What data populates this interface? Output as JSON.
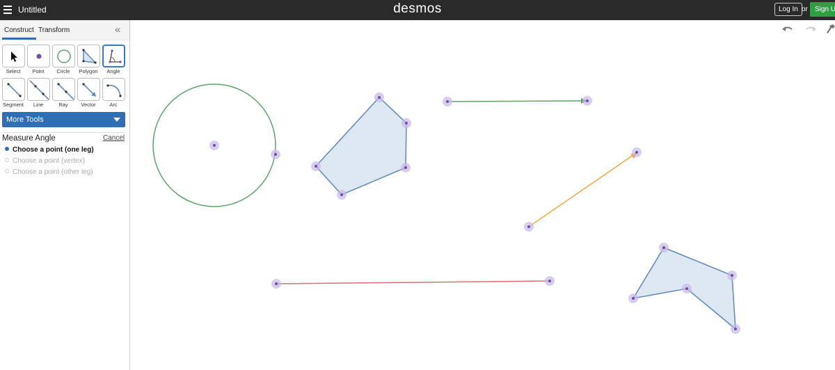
{
  "header": {
    "doc_title": "Untitled",
    "logo": "desmos",
    "login_label": "Log In",
    "or_label": "or",
    "signup_label": "Sign Up",
    "signup_color": "#2f9e44"
  },
  "sidebar": {
    "tabs": [
      {
        "label": "Construct",
        "active": true
      },
      {
        "label": "Transform",
        "active": false
      }
    ],
    "collapse_icon": "double-chevron-left-icon",
    "tools": [
      {
        "label": "Select",
        "icon": "cursor-icon",
        "selected": false
      },
      {
        "label": "Point",
        "icon": "point-icon",
        "selected": false
      },
      {
        "label": "Circle",
        "icon": "circle-icon",
        "selected": false
      },
      {
        "label": "Polygon",
        "icon": "polygon-icon",
        "selected": false
      },
      {
        "label": "Angle",
        "icon": "angle-icon",
        "selected": true
      },
      {
        "label": "Segment",
        "icon": "segment-icon",
        "selected": false
      },
      {
        "label": "Line",
        "icon": "line-icon",
        "selected": false
      },
      {
        "label": "Ray",
        "icon": "ray-icon",
        "selected": false
      },
      {
        "label": "Vector",
        "icon": "vector-icon",
        "selected": false
      },
      {
        "label": "Arc",
        "icon": "arc-icon",
        "selected": false
      }
    ],
    "more_tools_label": "More Tools",
    "measure": {
      "title": "Measure Angle",
      "cancel_label": "Cancel",
      "steps": [
        {
          "label": "Choose a point (one leg)",
          "state": "current"
        },
        {
          "label": "Choose a point (vertex)",
          "state": "pending"
        },
        {
          "label": "Choose a point (other leg)",
          "state": "pending"
        }
      ]
    }
  },
  "canvas": {
    "controls": [
      "undo-icon",
      "redo-icon",
      "wrench-icon"
    ],
    "colors": {
      "circle": "#5aa367",
      "polygon": "#5c87c0",
      "polygon_fill": "#d9e5f1",
      "vector_green": "#5aa367",
      "vector_orange": "#f0a542",
      "segment_red": "#d47070",
      "point": "#6b4fa8",
      "point_halo": "#c9b8e6"
    }
  }
}
